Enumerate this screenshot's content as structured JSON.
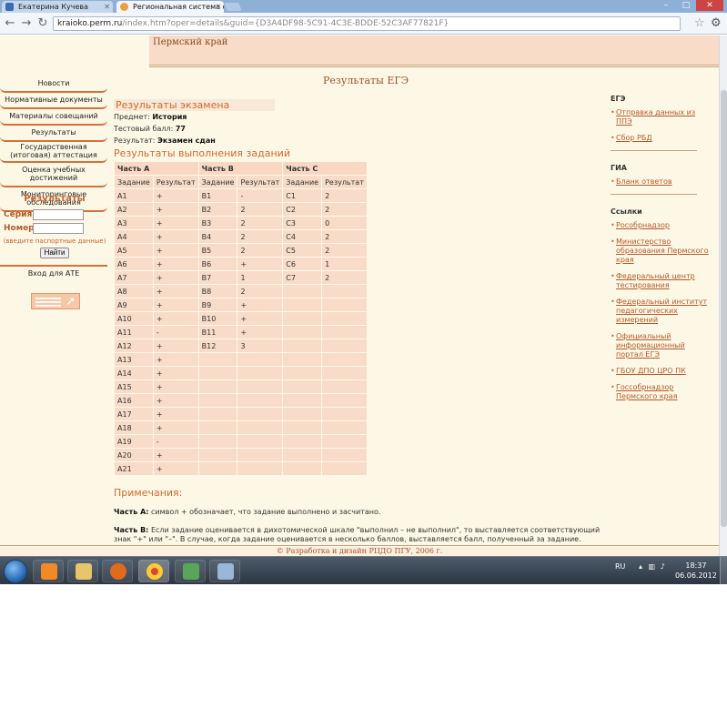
{
  "browser": {
    "tabs": [
      {
        "label": "Екатерина Кучева"
      },
      {
        "label": "Региональная система оц"
      }
    ],
    "url_host": "kraioko.perm.ru",
    "url_path": "/index.htm?oper=details&guid={D3A4DF98-5C91-4C3E-BDDE-52C3AF77821F}"
  },
  "header": {
    "region": "Пермский край",
    "page_title": "Результаты ЕГЭ"
  },
  "leftnav": {
    "items": [
      "Новости",
      "Нормативные документы",
      "Материалы совещаний",
      "Результаты",
      "Государственная (итоговая) аттестация",
      "Оценка учебных достижений",
      "Мониторинговые обследования"
    ],
    "login": {
      "title": "Результаты",
      "series_label": "Серия",
      "number_label": "Номер",
      "series_value": "",
      "number_value": "",
      "hint": "(введите паспортные данные)",
      "button": "Найти"
    },
    "ate_link": "Вход для АТЕ"
  },
  "exam": {
    "section_title": "Результаты экзамена",
    "subject_label": "Предмет:",
    "subject": "История",
    "score_label": "Тестовый балл:",
    "score": "77",
    "result_label": "Результат:",
    "result": "Экзамен сдан",
    "tasks_title": "Результаты выполнения заданий"
  },
  "table": {
    "parts": [
      "Часть А",
      "Часть В",
      "Часть С"
    ],
    "col_task": "Задание",
    "col_result": "Результат",
    "part_a": [
      [
        "A1",
        "+"
      ],
      [
        "A2",
        "+"
      ],
      [
        "A3",
        "+"
      ],
      [
        "A4",
        "+"
      ],
      [
        "A5",
        "+"
      ],
      [
        "A6",
        "+"
      ],
      [
        "A7",
        "+"
      ],
      [
        "A8",
        "+"
      ],
      [
        "A9",
        "+"
      ],
      [
        "A10",
        "+"
      ],
      [
        "A11",
        "-"
      ],
      [
        "A12",
        "+"
      ],
      [
        "A13",
        "+"
      ],
      [
        "A14",
        "+"
      ],
      [
        "A15",
        "+"
      ],
      [
        "A16",
        "+"
      ],
      [
        "A17",
        "+"
      ],
      [
        "A18",
        "+"
      ],
      [
        "A19",
        "-"
      ],
      [
        "A20",
        "+"
      ],
      [
        "A21",
        "+"
      ]
    ],
    "part_b": [
      [
        "B1",
        "-"
      ],
      [
        "B2",
        "2"
      ],
      [
        "B3",
        "2"
      ],
      [
        "B4",
        "2"
      ],
      [
        "B5",
        "2"
      ],
      [
        "B6",
        "+"
      ],
      [
        "B7",
        "1"
      ],
      [
        "B8",
        "2"
      ],
      [
        "B9",
        "+"
      ],
      [
        "B10",
        "+"
      ],
      [
        "B11",
        "+"
      ],
      [
        "B12",
        "3"
      ]
    ],
    "part_c": [
      [
        "C1",
        "2"
      ],
      [
        "C2",
        "2"
      ],
      [
        "C3",
        "0"
      ],
      [
        "C4",
        "2"
      ],
      [
        "C5",
        "2"
      ],
      [
        "C6",
        "1"
      ],
      [
        "C7",
        "2"
      ]
    ]
  },
  "notes": {
    "title": "Примечания:",
    "a_label": "Часть А:",
    "a_text": "символ + обозначает, что задание выполнено и засчитано.",
    "b_label": "Часть В:",
    "b_text": "Если задание оценивается в дихотомической шкале \"выполнил – не выполнил\", то выставляется соответствующий знак \"+\" или \"–\". В случае, когда задание оценивается в несколько баллов, выставляется балл, полученный за задание."
  },
  "rightcol": {
    "ege_title": "ЕГЭ",
    "ege_links": [
      "Отправка данных из ППЭ",
      "Сбор РБД"
    ],
    "gia_title": "ГИА",
    "gia_links": [
      "Бланк ответов"
    ],
    "links_title": "Ссылки",
    "links": [
      "Рособрнадзор",
      "Министерство образования Пермского края",
      "Федеральный центр тестирования",
      "Федеральный институт педагогических измерений",
      "Официальный информационный портал ЕГЭ",
      "ГБОУ ДПО ЦРО ПК",
      "Госсобрнадзор Пермского края"
    ]
  },
  "footer": "© Разработка и дизайн РЦДО ПГУ, 2006 г.",
  "taskbar": {
    "lang": "RU",
    "time": "18:37",
    "date": "06.06.2012"
  }
}
